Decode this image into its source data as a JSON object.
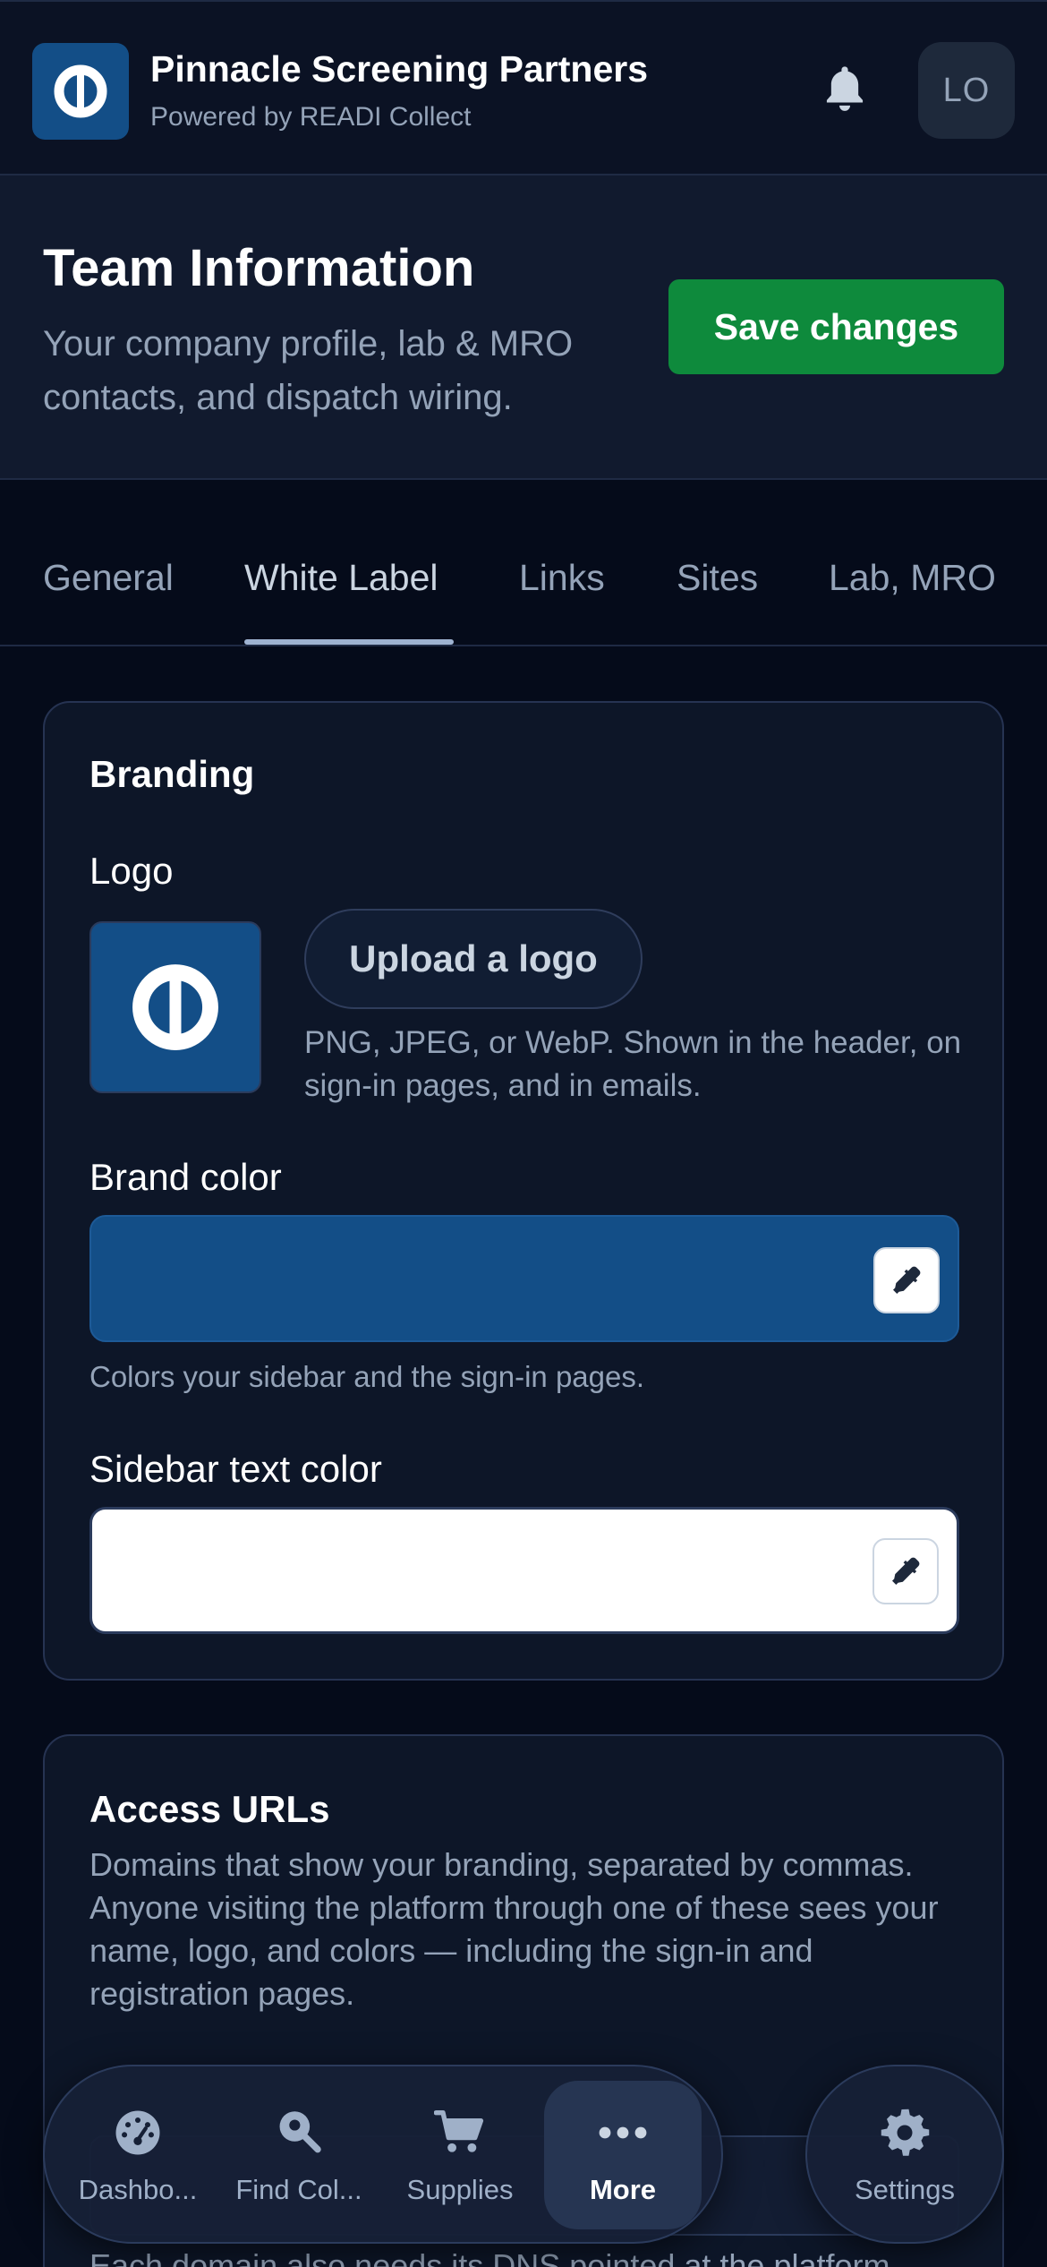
{
  "app": {
    "name": "Pinnacle Screening Partners",
    "subtitle": "Powered by READI Collect",
    "avatar_initials": "LO",
    "brand_color": "#134e87",
    "logo_icon": "circle-bar-logo",
    "bell_icon": "bell-icon"
  },
  "header": {
    "title": "Team Information",
    "description": "Your company profile, lab & MRO contacts, and dispatch wiring.",
    "save_label": "Save changes",
    "save_color": "#0e8a3c"
  },
  "tabs": [
    {
      "label": "General",
      "active": false
    },
    {
      "label": "White Label",
      "active": true
    },
    {
      "label": "Links",
      "active": false
    },
    {
      "label": "Sites",
      "active": false
    },
    {
      "label": "Lab, MRO",
      "active": false
    }
  ],
  "branding": {
    "title": "Branding",
    "logo_label": "Logo",
    "upload_label": "Upload a logo",
    "upload_hint": "PNG, JPEG, or WebP. Shown in the header, on sign-in pages, and in emails.",
    "brand_color_label": "Brand color",
    "brand_color_value": "#134e87",
    "brand_color_hint": "Colors your sidebar and the sign-in pages.",
    "sidebar_text_label": "Sidebar text color",
    "sidebar_text_value": "#ffffff",
    "eyedropper_icon": "eyedropper-icon"
  },
  "access": {
    "title": "Access URLs",
    "description": "Domains that show your branding, separated by commas. Anyone visiting the platform through one of these sees your name, logo, and colors — including the sign-in and registration pages.",
    "dns_note": "Each domain also needs its DNS pointed at the platform"
  },
  "nav": {
    "items": [
      {
        "label": "Dashbo...",
        "icon": "gauge-icon",
        "active": false
      },
      {
        "label": "Find Col...",
        "icon": "search-pin-icon",
        "active": false
      },
      {
        "label": "Supplies",
        "icon": "cart-icon",
        "active": false
      },
      {
        "label": "More",
        "icon": "more-icon",
        "active": true
      }
    ],
    "settings": {
      "label": "Settings",
      "icon": "gear-icon"
    }
  }
}
